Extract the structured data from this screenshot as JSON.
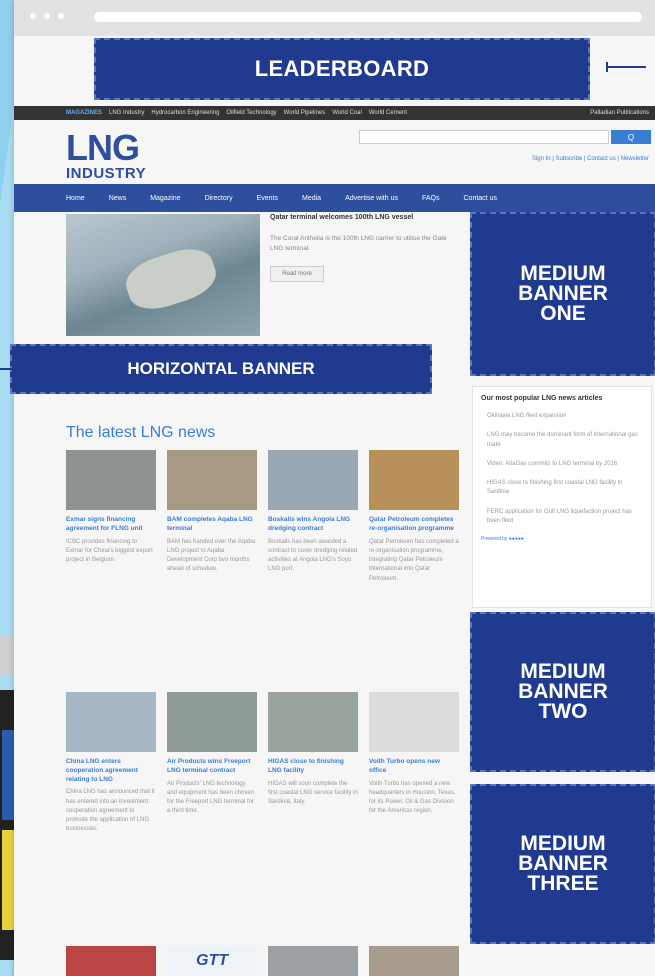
{
  "ads": {
    "leaderboard": "LEADERBOARD",
    "horizontal": "HORIZONTAL BANNER",
    "medium_one": "MEDIUM BANNER ONE",
    "medium_two": "MEDIUM BANNER TWO",
    "medium_three": "MEDIUM BANNER THREE"
  },
  "topbar": {
    "magazines": "MAGAZINES",
    "sites": [
      "LNG Industry",
      "Hydrocarbon Engineering",
      "Oilfield Technology",
      "World Pipelines",
      "World Coal",
      "World Cement"
    ],
    "right": "Palladian Publications"
  },
  "logo": {
    "line1": "LNG",
    "line2": "INDUSTRY"
  },
  "search": {
    "button": "Q",
    "placeholder": ""
  },
  "user_links": "Sign In | Subscribe | Contact us | Newsletter",
  "nav": [
    "Home",
    "News",
    "Magazine",
    "Directory",
    "Events",
    "Media",
    "Advertise with us",
    "FAQs",
    "Contact us"
  ],
  "hero": {
    "title": "Qatar terminal welcomes 100th LNG vessel",
    "desc": "The Coral Anthelia is the 100th LNG carrier to utilise the Gate LNG terminal.",
    "button": "Read more"
  },
  "latest": {
    "title": "The latest LNG news",
    "cards": [
      {
        "title": "Exmar signs financing agreement for FLNG unit",
        "desc": "ICBC provides financing to Exmar for China's biggest export project in Belgium.",
        "color": "#8e9493"
      },
      {
        "title": "BAM completes Aqaba LNG terminal",
        "desc": "BAM has handed over the Aqaba LNG project to Aqaba Development Corp two months ahead of schedule.",
        "color": "#a69a84"
      },
      {
        "title": "Boskalis wins Angola LNG dredging contract",
        "desc": "Boskalis has been awarded a contract to cover dredging related activities at Angola LNG's Soyo LNG port.",
        "color": "#9aa8b4"
      },
      {
        "title": "Qatar Petroleum completes re-organisation programme",
        "desc": "Qatar Petroleum has completed a re-organisation programme, integrating Qatar Petroleum International into Qatar Petroleum.",
        "color": "#b8905a"
      },
      {
        "title": "China LNG enters cooperation agreement relating to LNG",
        "desc": "China LNG has announced that it has entered into an investment cooperation agreement to promote the application of LNG businesses.",
        "color": "#a7b6c3"
      },
      {
        "title": "Air Products wins Freeport LNG terminal contract",
        "desc": "Air Products' LNG technology and equipment has been chosen for the Freeport LNG terminal for a third time.",
        "color": "#8f9c97"
      },
      {
        "title": "HIGAS close to finishing LNG facility",
        "desc": "HIGAS will soon complete the first coastal LNG service facility in Sardinia, Italy.",
        "color": "#9aa39c"
      },
      {
        "title": "Voith Turbo opens new office",
        "desc": "Voith Turbo has opened a new headquarters in Houston, Texas, for its Power, Oil & Gas Division for the Americas region.",
        "color": "#dcdcdc"
      }
    ]
  },
  "popular": {
    "title": "Our most popular LNG news articles",
    "items": [
      "Okinawa LNG fleet expansion",
      "LNG may become the dominant form of international gas trade",
      "Video: AltaGas commits to LNG terminal by 2016",
      "HIGAS close to finishing first coastal LNG facility in Sardinia",
      "FERC application for Gulf LNG liquefaction project has been filed"
    ],
    "powered": "Powered by ●●●●●"
  },
  "bottom_thumbs": [
    {
      "label": "",
      "color": "#b44"
    },
    {
      "label": "GTT",
      "color": "#eef3f7"
    },
    {
      "label": "",
      "color": "#9aa0a4"
    },
    {
      "label": "",
      "color": "#a89c8e"
    }
  ]
}
